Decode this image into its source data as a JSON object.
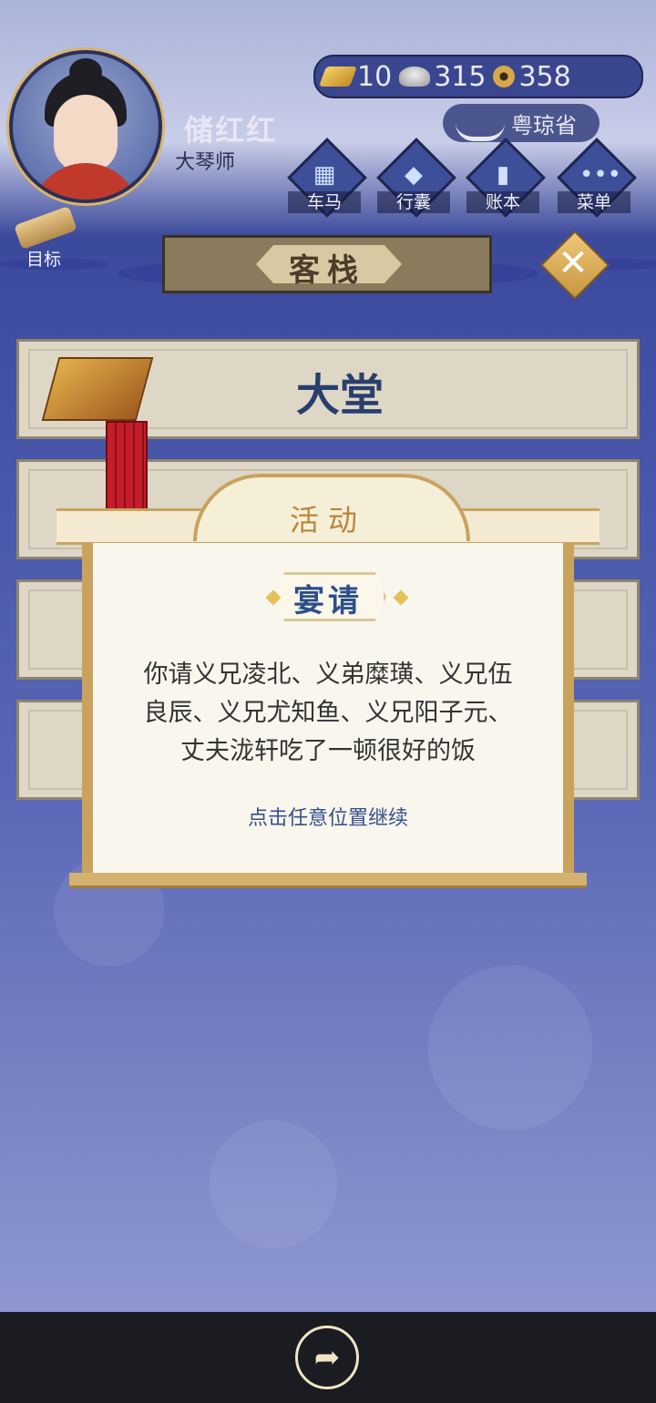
{
  "player": {
    "name": "储红红",
    "title": "大琴师"
  },
  "currency": {
    "gold": "10",
    "silver": "315",
    "coins": "358"
  },
  "province": "粤琼省",
  "menu": [
    {
      "label": "车马",
      "icon": "carriage-icon"
    },
    {
      "label": "行囊",
      "icon": "bundle-icon"
    },
    {
      "label": "账本",
      "icon": "ledger-icon"
    },
    {
      "label": "菜单",
      "icon": "more-icon"
    }
  ],
  "goal_label": "目标",
  "location_title": "客栈",
  "rooms": [
    {
      "label": "大堂"
    }
  ],
  "popup": {
    "header": "活动",
    "subtitle": "宴请",
    "message_lines": [
      "你请义兄凌北、义弟糜璜、义兄伍",
      "良辰、义兄尤知鱼、义兄阳子元、",
      "丈夫泷轩吃了一顿很好的饭"
    ],
    "hint": "点击任意位置继续"
  },
  "colors": {
    "accent_gold": "#c9a35e",
    "navy": "#3b4a9a",
    "text_blue": "#2b4f8a"
  }
}
